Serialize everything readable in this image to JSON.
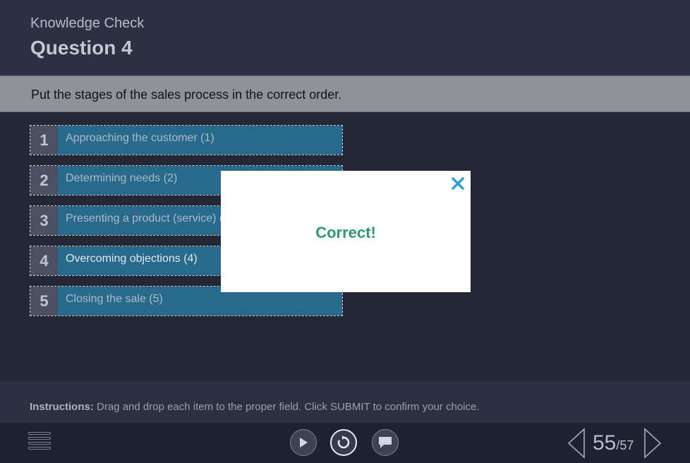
{
  "header": {
    "section_label": "Knowledge Check",
    "question_title": "Question 4"
  },
  "prompt": {
    "text": "Put the stages of the sales process in the correct order."
  },
  "items": [
    {
      "number": "1",
      "label": "Approaching the customer (1)"
    },
    {
      "number": "2",
      "label": "Determining needs (2)"
    },
    {
      "number": "3",
      "label": "Presenting a product (service) (3)"
    },
    {
      "number": "4",
      "label": "Overcoming objections (4)"
    },
    {
      "number": "5",
      "label": "Closing the sale (5)"
    }
  ],
  "popup": {
    "message": "Correct!",
    "close_icon": "close-icon"
  },
  "instructions": {
    "label": "Instructions:",
    "text": " Drag and drop each item to the proper field. Click SUBMIT to confirm your choice."
  },
  "footer": {
    "icons": [
      "menu-icon",
      "play-icon",
      "replay-icon",
      "comment-icon",
      "prev-arrow-icon",
      "next-arrow-icon"
    ],
    "page_current": "55",
    "page_total": "/57"
  },
  "colors": {
    "background": "#232634",
    "item_fill": "#276a8c",
    "correct_text": "#2a9b6b",
    "close_icon": "#2a9fd6"
  }
}
